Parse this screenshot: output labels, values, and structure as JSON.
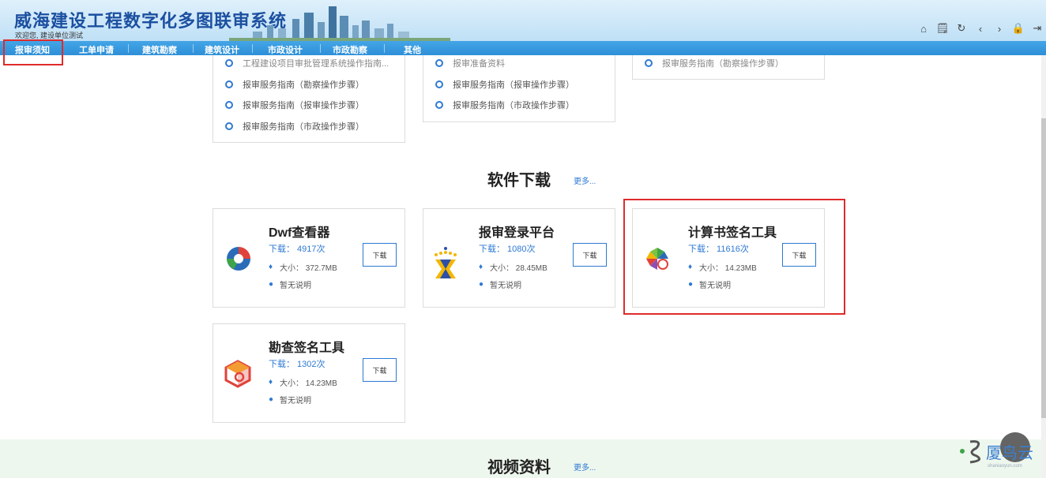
{
  "header": {
    "title": "威海建设工程数字化多图联审系统",
    "welcome": "欢迎您, 建设单位测试",
    "icons": [
      "home-icon",
      "document-icon",
      "refresh-icon",
      "back-icon",
      "forward-icon",
      "lock-icon",
      "logout-icon"
    ]
  },
  "nav": {
    "items": [
      "报审须知",
      "工单申请",
      "建筑勘察",
      "建筑设计",
      "市政设计",
      "市政勘察",
      "其他"
    ]
  },
  "guides": {
    "col1": [
      "工程建设项目审批管理系统操作指南...",
      "报审服务指南（勘察操作步骤）",
      "报审服务指南（报审操作步骤）",
      "报审服务指南（市政操作步骤）"
    ],
    "col2": [
      "报审准备资料",
      "报审服务指南（报审操作步骤）",
      "报审服务指南（市政操作步骤）"
    ],
    "col3": [
      "报审服务指南（勘察操作步骤）"
    ]
  },
  "software": {
    "title": "软件下载",
    "more": "更多...",
    "download_label": "下载",
    "items": [
      {
        "name": "Dwf查看器",
        "downloads": "下载：  4917次",
        "size": "大小：  372.7MB",
        "desc": "暂无说明",
        "icon": "dwf-viewer-icon"
      },
      {
        "name": "报审登录平台",
        "downloads": "下载：  1080次",
        "size": "大小：  28.45MB",
        "desc": "暂无说明",
        "icon": "login-platform-icon"
      },
      {
        "name": "计算书签名工具",
        "downloads": "下载：  11616次",
        "size": "大小：  14.23MB",
        "desc": "暂无说明",
        "icon": "calc-sign-tool-icon"
      },
      {
        "name": "勘查签名工具",
        "downloads": "下载：  1302次",
        "size": "大小：  14.23MB",
        "desc": "暂无说明",
        "icon": "survey-sign-tool-icon"
      }
    ]
  },
  "video": {
    "title": "视频资料",
    "more": "更多..."
  },
  "watermark": {
    "text": "厦鸟云",
    "sub": "shaniaoyun.com"
  },
  "colors": {
    "accent": "#2e79d3",
    "nav": "#2d8fd8",
    "highlight": "#e02b2b"
  }
}
